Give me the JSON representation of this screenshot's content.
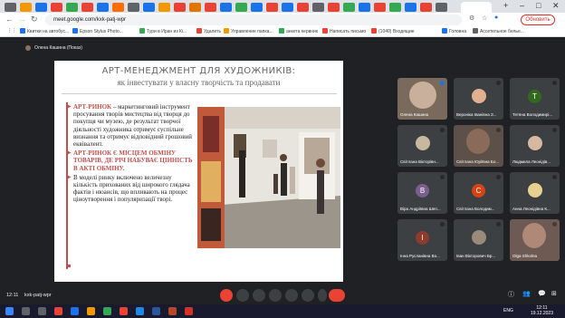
{
  "browser": {
    "url": "meet.google.com/kxk-patj-wpr",
    "update_label": "Обновить",
    "bookmarks": [
      "Квитки на автобус...",
      "Epson Stylus Photo...",
      "Тури в Иран из Кі...",
      "Удалить",
      "Управление папка...",
      "анкета кервник",
      "Написать письмо",
      "(1040) Входящие",
      "Головна",
      "Ассетельное белье..."
    ]
  },
  "meet": {
    "presenter_label": "Олена Кашина (Показ)",
    "time": "12:11",
    "meeting_code": "kxk-patj-wpr",
    "participants": [
      {
        "name": "Олена Кашина",
        "type": "photo",
        "color": "#b0a090"
      },
      {
        "name": "Вероніка Іванівна З...",
        "type": "photo",
        "color": "#e0b090"
      },
      {
        "name": "Тетяна Володимирі...",
        "type": "letter",
        "letter": "Т",
        "color": "#33691e"
      },
      {
        "name": "Світлана Вікторівн...",
        "type": "photo",
        "color": "#c8b8a0"
      },
      {
        "name": "Світлана Юріївна Бо...",
        "type": "photo",
        "color": "#6d4c41"
      },
      {
        "name": "Людмила Леонідів...",
        "type": "photo",
        "color": "#d7b8a0"
      },
      {
        "name": "Віра Андріївна Шеп...",
        "type": "letter",
        "letter": "В",
        "color": "#7b5e8e"
      },
      {
        "name": "Світлана Володим...",
        "type": "letter",
        "letter": "С",
        "color": "#d84315"
      },
      {
        "name": "Анна Леонідівна К...",
        "type": "photo",
        "color": "#e8d090"
      },
      {
        "name": "Інна Русланівна Во...",
        "type": "letter",
        "letter": "І",
        "color": "#8d3b2f"
      },
      {
        "name": "Іван Вікторович Бр...",
        "type": "photo",
        "color": "#9a8a7a"
      },
      {
        "name": "Olga Shkolna",
        "type": "photo",
        "color": "#8d6e63"
      }
    ]
  },
  "slide": {
    "title": "АРТ-МЕНЕДЖМЕНТ ДЛЯ ХУДОЖНИКІВ:",
    "subtitle": "як інвестувати у власну творчість та продавати",
    "bullets": [
      {
        "emph": "АРТ-РИНОК",
        "text": " – маркетинговий інструмент просування творів мистецтва від творця до покупця чи музею, де результат творчої діяльності художника отримує суспільне визнання та отримує відповідний грошовий еквівалент."
      },
      {
        "emph": "АРТ-РИНОК Є МІСЦЕМ ОБМІНУ ТОВАРІВ, ДЕ РІЧ НАБУВАЄ ЦІННІСТЬ В АКТІ ОБМІНУ.",
        "text": ""
      },
      {
        "emph": "",
        "text": "В моделі ринку включено величезну кількість прихованих від широкого глядача фактів і нюансів, що впливають на процес ціноутворення і популяризації творі."
      }
    ],
    "accent_color": "#c0504d"
  },
  "taskbar": {
    "time": "12:11",
    "date": "19.12.2023",
    "lang": "ENG"
  }
}
